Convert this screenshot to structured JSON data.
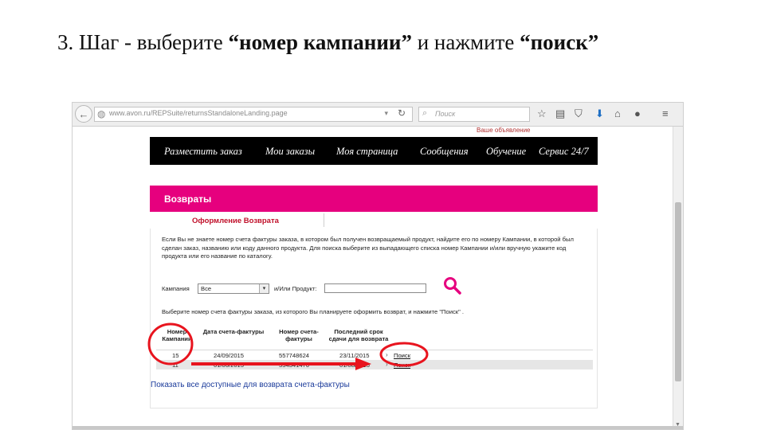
{
  "slide": {
    "title_prefix": "3. Шаг - выберите ",
    "title_bold1": "“номер кампании”",
    "title_mid": " и нажмите ",
    "title_bold2": "“поиск”"
  },
  "browser": {
    "url": "www.avon.ru/REPSuite/returnsStandaloneLanding.page",
    "search_placeholder": "Поиск",
    "page_fragment": "Ваше объявление"
  },
  "navbar": {
    "items": [
      "Разместить заказ",
      "Мои заказы",
      "Моя страница",
      "Сообщения",
      "Обучение",
      "Сервис 24/7"
    ]
  },
  "section": {
    "title": "Возвраты",
    "tab": "Оформление Возврата"
  },
  "content": {
    "instruction": "Если Вы не знаете номер счета фактуры заказа, в котором был получен возвращаемый продукт, найдите его по номеру Кампании, в которой был сделан заказ, названию или коду данного продукта. Для поиска выберите из выпадающего списка номер Кампании и/или вручную укажите код продукта или его название по каталогу.",
    "campaign_label": "Кампания",
    "campaign_value": "Все",
    "product_label": "и/Или Продукт:",
    "select_hint": "Выберите номер счета фактуры заказа, из которого Вы планируете оформить возврат, и нажмите \"Поиск\" ."
  },
  "table": {
    "headers": [
      "Номер Кампании",
      "Дата счета-фактуры",
      "Номер счета-фактуры",
      "Последний срок сдачи для возврата"
    ],
    "rows": [
      {
        "campaign": "15",
        "date": "24/09/2015",
        "invoice": "557748624",
        "deadline": "23/11/2015",
        "action": "Поиск"
      },
      {
        "campaign": "11",
        "date": "01/06/2015",
        "invoice": "554341476",
        "deadline": "01/08/2015",
        "action": "Поиск"
      }
    ]
  },
  "footer": {
    "show_all": "Показать все доступные для возврата счета-фактуры"
  },
  "colors": {
    "brand_pink": "#e6007e",
    "nav_bg": "#000000",
    "annotation_red": "#e8141e"
  }
}
